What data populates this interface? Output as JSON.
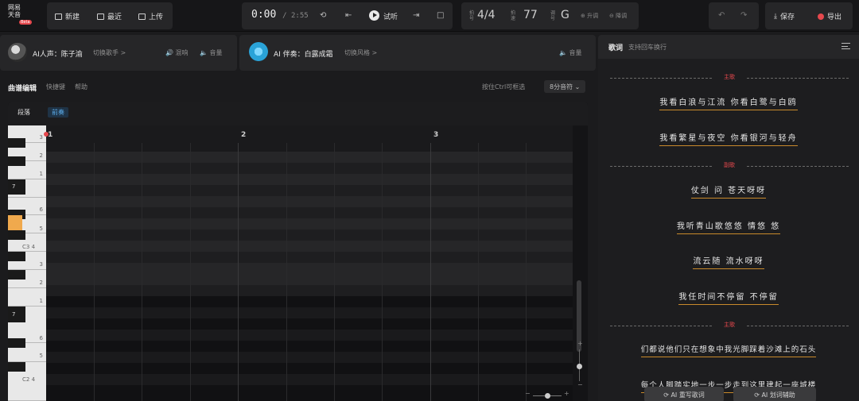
{
  "app": {
    "logo_lines": [
      "网易",
      "天音"
    ],
    "logo_badge": "Beta"
  },
  "toolbar": {
    "new_label": "新建",
    "recent_label": "最近",
    "upload_label": "上传"
  },
  "transport": {
    "current_time": "0:00",
    "total_time": "/ 2:55",
    "preview_label": "试听"
  },
  "meta": {
    "beat_label": "拍号",
    "beat_value": "4/4",
    "tempo_label": "拍速",
    "tempo_value": "77",
    "key_label": "调号",
    "key_value": "G",
    "key_up": "升调",
    "key_down": "降调"
  },
  "actions": {
    "save_label": "保存",
    "export_label": "导出"
  },
  "voice": {
    "singer_label": "AI人声：陈子渝",
    "switch_singer": "切换歌手 >",
    "reverb_label": "混响",
    "volume_label": "音量",
    "accomp_label": "AI 伴奏：白露成霜",
    "switch_style": "切换风格 >",
    "accomp_volume_label": "音量"
  },
  "editor": {
    "title": "曲谱编辑",
    "shortcut_label": "快捷键",
    "help_label": "帮助",
    "ctrl_hint": "按住Ctrl可框选",
    "note_select": "8分音符",
    "section_label": "段落",
    "intro_tab": "前奏",
    "bars": [
      "1",
      "2",
      "3"
    ],
    "key_labels": [
      "3",
      "2",
      "1",
      "7",
      "6",
      "5",
      "C3 4",
      "3",
      "2",
      "1",
      "7",
      "6",
      "5",
      "C2 4"
    ]
  },
  "lyrics": {
    "title": "歌词",
    "subtitle": "支持回车换行",
    "sections": [
      {
        "name": "主歌",
        "lines": [
          "我看白浪与江流 你看白鹭与白鸥",
          "我看繁星与夜空 你看银河与轻舟"
        ]
      },
      {
        "name": "副歌",
        "lines": [
          "仗剑 问 苍天呀呀",
          "我听青山歌悠悠 情悠 悠",
          "流云随 流水呀呀",
          "我任时间不停留 不停留"
        ]
      },
      {
        "name": "主歌",
        "lines": [
          "们都说他们只在想象中我光脚踩着沙滩上的石头",
          "每个人脚踏实地一步一步走到这里建起一座城楼"
        ]
      }
    ],
    "ai_rewrite": "AI 重写歌词",
    "ai_assist": "AI 划词辅助"
  },
  "colors": {
    "accent": "#e5484d",
    "underline": "#c98a2b",
    "highlight_key": "#f0a94d"
  }
}
